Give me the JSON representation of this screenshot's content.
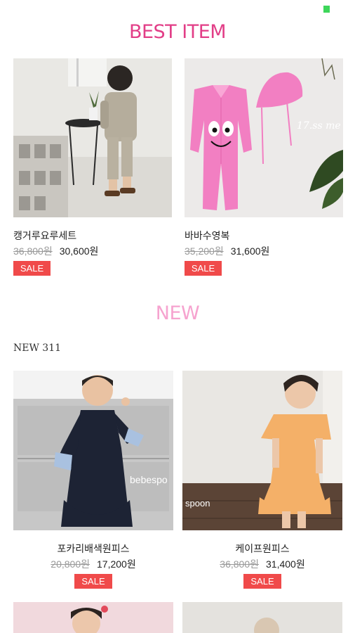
{
  "best": {
    "title": "BEST ITEM",
    "products": [
      {
        "name": "캥거루요루세트",
        "original_price": "36,800원",
        "sale_price": "30,600원",
        "badge": "SALE"
      },
      {
        "name": "바바수영복",
        "original_price": "35,200원",
        "sale_price": "31,600원",
        "badge": "SALE"
      }
    ]
  },
  "new": {
    "title": "NEW",
    "count_label": "NEW 311",
    "products": [
      {
        "name": "포카리배색원피스",
        "original_price": "20,800원",
        "sale_price": "17,200원",
        "badge": "SALE",
        "photo_text": "bebespo"
      },
      {
        "name": "케이프원피스",
        "original_price": "36,800원",
        "sale_price": "31,400원",
        "badge": "SALE",
        "photo_text": "spoon"
      }
    ]
  },
  "colors": {
    "best_title": "#e23e87",
    "new_title": "#f6a3cf",
    "sale_badge": "#f04a4a",
    "status_indicator": "#3dd65a"
  }
}
